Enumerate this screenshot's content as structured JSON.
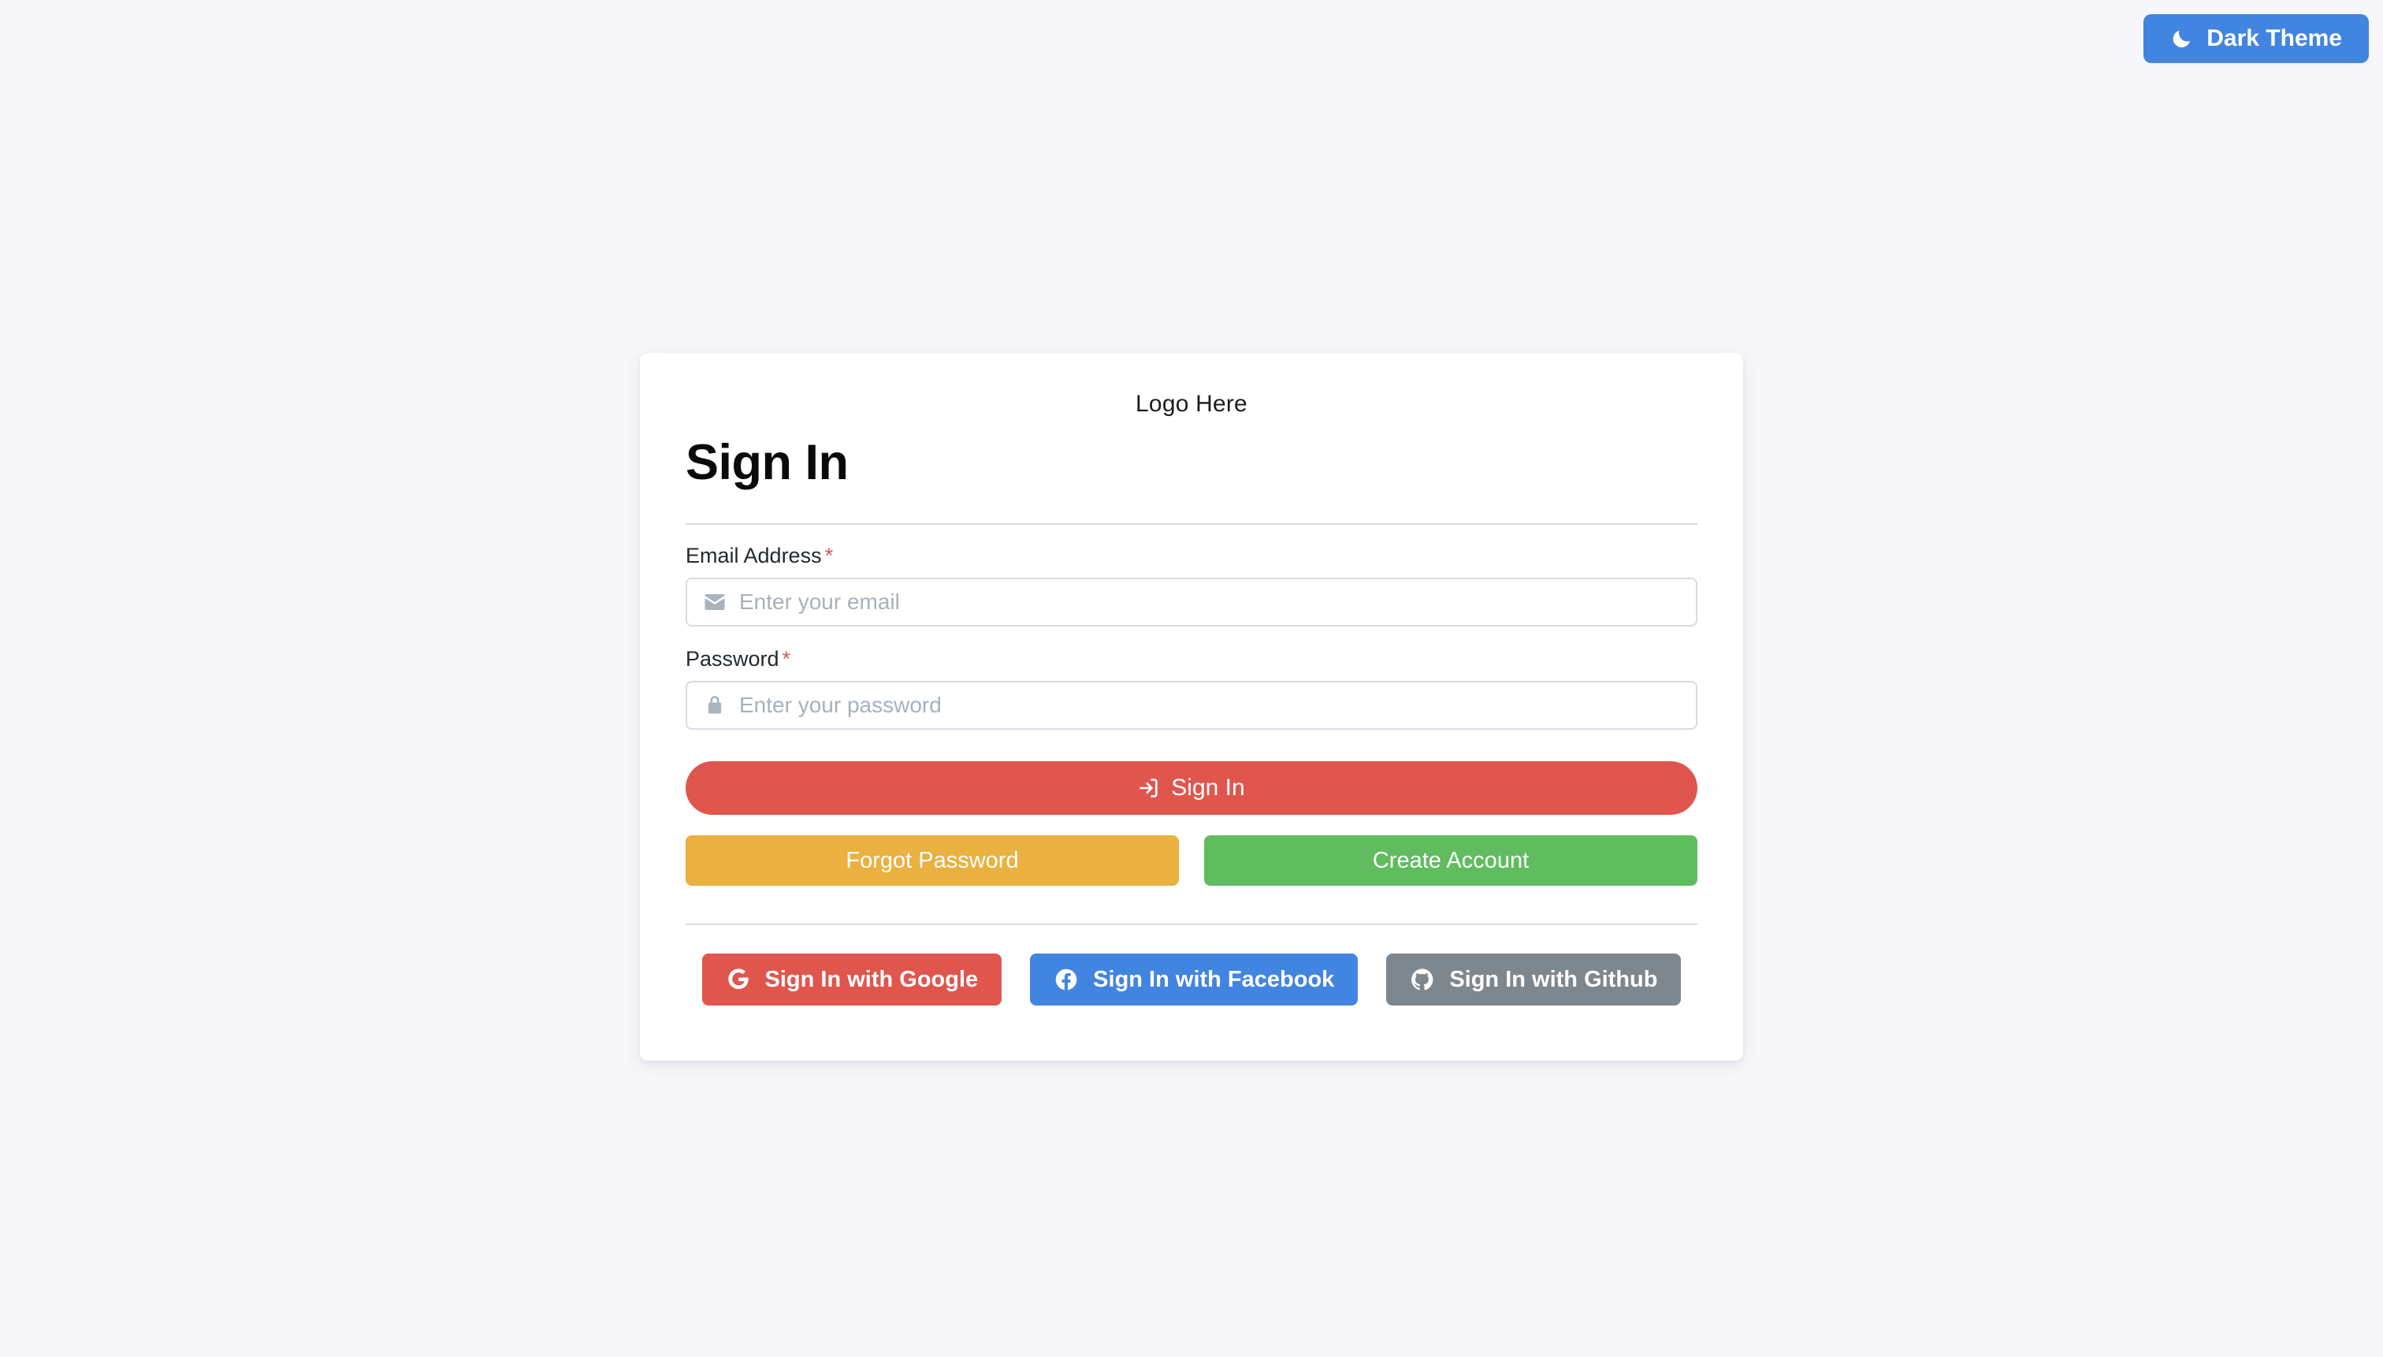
{
  "page": {
    "background_color": "#f7f7fb"
  },
  "theme_toggle": {
    "label": "Dark Theme",
    "icon": "moon-icon",
    "color": "#4285e0"
  },
  "card": {
    "logo_text": "Logo Here",
    "title": "Sign In",
    "form": {
      "email": {
        "label": "Email Address",
        "required_marker": "*",
        "placeholder": "Enter your email",
        "value": "",
        "icon": "envelope-icon"
      },
      "password": {
        "label": "Password",
        "required_marker": "*",
        "placeholder": "Enter your password",
        "value": "",
        "icon": "lock-icon"
      },
      "submit": {
        "label": "Sign In",
        "icon": "sign-in-arrow-icon",
        "color": "#e0564d"
      },
      "forgot_password": {
        "label": "Forgot Password",
        "color": "#eab040"
      },
      "create_account": {
        "label": "Create Account",
        "color": "#60bd5f"
      }
    },
    "social": [
      {
        "label": "Sign In with Google",
        "icon": "google-icon",
        "color": "#e0564d"
      },
      {
        "label": "Sign In with Facebook",
        "icon": "facebook-icon",
        "color": "#4285e0"
      },
      {
        "label": "Sign In with Github",
        "icon": "github-icon",
        "color": "#7e868e"
      }
    ]
  }
}
